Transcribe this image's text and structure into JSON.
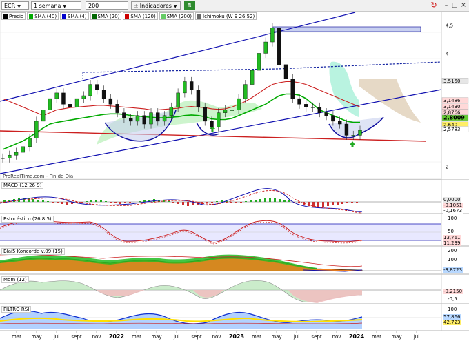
{
  "toolbar": {
    "symbol": "ECR",
    "period": "1 semana",
    "units": "200 unidades",
    "indicators": "Indicadores"
  },
  "legend": {
    "items": [
      {
        "label": "Precio",
        "color": "#000000"
      },
      {
        "label": "SMA (40)",
        "color": "#00aa00"
      },
      {
        "label": "SMA (4)",
        "color": "#0000cc"
      },
      {
        "label": "SMA (20)",
        "color": "#006600"
      },
      {
        "label": "SMA (120)",
        "color": "#cc0000"
      },
      {
        "label": "SMA (200)",
        "color": "#66cc66"
      },
      {
        "label": "Ichimoku (W 9 26 52)",
        "color": "#666666"
      }
    ]
  },
  "watermark": "ProRealTime.com - Fin de Día",
  "panels": {
    "macd": {
      "label": "MACD (12 26 9)",
      "values": [
        "0,0000",
        "-0,1051",
        "-0,1673"
      ]
    },
    "stoch": {
      "label": "Estocástico (26 8 5)",
      "ticks": [
        "100",
        "50",
        "0"
      ],
      "values": [
        "13,761",
        "11,239"
      ]
    },
    "blai": {
      "label": "Blai5 Koncorde v.09 (15)",
      "ticks": [
        "200",
        "100",
        "0",
        "-100"
      ],
      "values": [
        "-3,8723"
      ]
    },
    "mom": {
      "label": "Mom (12)",
      "ticks": [
        "0",
        "-0,5"
      ],
      "values": [
        "-0,2150"
      ]
    },
    "rsi": {
      "label": "FILTRO RSI",
      "ticks": [
        "100",
        "50",
        "0"
      ],
      "values": [
        "57,866",
        "42,723"
      ]
    }
  },
  "x_axis_labels": [
    "mar",
    "may",
    "jul",
    "sept",
    "nov",
    "2022",
    "mar",
    "may",
    "jul",
    "sept",
    "nov",
    "2023",
    "mar",
    "may",
    "jul",
    "sept",
    "nov",
    "2024",
    "mar",
    "may",
    "jul"
  ],
  "chart_data": {
    "type": "line",
    "series": [
      {
        "name": "Precio",
        "values": [
          2.15,
          2.2,
          2.25,
          2.35,
          2.5,
          2.8,
          3.0,
          3.2,
          3.3,
          3.1,
          3.05,
          3.2,
          3.25,
          3.45,
          3.35,
          3.2,
          3.1,
          2.95,
          2.85,
          2.8,
          2.9,
          2.75,
          2.95,
          2.8,
          2.9,
          3.05,
          3.3,
          3.5,
          3.35,
          3.05,
          2.8,
          2.7,
          2.95,
          3.0,
          3.0,
          3.2,
          3.45,
          3.7,
          4.0,
          4.2,
          4.45,
          3.8,
          3.55,
          3.2,
          3.1,
          3.05,
          3.05,
          2.95,
          2.9,
          2.8,
          2.75,
          2.55,
          2.55,
          2.64
        ]
      },
      {
        "name": "SMA (40)",
        "values": [
          2.3,
          2.35,
          2.4,
          2.45,
          2.52,
          2.6,
          2.68,
          2.75,
          2.78,
          2.8,
          2.82,
          2.84,
          2.86,
          2.88,
          2.9,
          2.92,
          2.93,
          2.93,
          2.92,
          2.9,
          2.89,
          2.88,
          2.87,
          2.86,
          2.86,
          2.87,
          2.88,
          2.9,
          2.91,
          2.9,
          2.88,
          2.84,
          2.83,
          2.83,
          2.85,
          2.9,
          2.95,
          3.0,
          3.05,
          3.1,
          3.18,
          3.25,
          3.28,
          3.28,
          3.26,
          3.2,
          3.1,
          3.0,
          2.95,
          2.9,
          2.85,
          2.8,
          2.78,
          2.78
        ]
      },
      {
        "name": "SMA (120)",
        "values": [
          3.2,
          3.15,
          3.1,
          3.05,
          3.0,
          2.95,
          2.9,
          2.95,
          3.0,
          3.02,
          3.04,
          3.05,
          3.06,
          3.07,
          3.08,
          3.08,
          3.07,
          3.06,
          3.05,
          3.04,
          3.03,
          3.02,
          3.0,
          3.0,
          3.01,
          3.02,
          3.03,
          3.05,
          3.06,
          3.05,
          3.04,
          3.02,
          3.01,
          3.02,
          3.05,
          3.1,
          3.15,
          3.22,
          3.3,
          3.38,
          3.45,
          3.48,
          3.5,
          3.5,
          3.48,
          3.45,
          3.4,
          3.35,
          3.3,
          3.25,
          3.2,
          3.15,
          3.1,
          3.05
        ]
      }
    ],
    "y_ticks": [
      "4,5",
      "4",
      "2"
    ],
    "y_tick_values": [
      4.5,
      4.0,
      2.0
    ],
    "ylim": [
      1.8,
      4.7
    ],
    "price_labels": [
      {
        "text": "3,5150",
        "value": 3.515,
        "color": "#e6e6e6"
      },
      {
        "text": "3,1486",
        "value": 3.17,
        "color": "#ffd8d8"
      },
      {
        "text": "3,1430",
        "value": 3.06,
        "color": "#ffd8d8"
      },
      {
        "text": "2,8766",
        "value": 2.96,
        "color": "#ffd8d8"
      },
      {
        "text": "2,8009",
        "value": 2.86,
        "color": "#66cc33",
        "bold": true
      },
      {
        "text": "2,640",
        "value": 2.74,
        "color": "#ffee66"
      },
      {
        "text": "2,5783",
        "value": 2.66,
        "color": "#ffffff"
      }
    ]
  }
}
